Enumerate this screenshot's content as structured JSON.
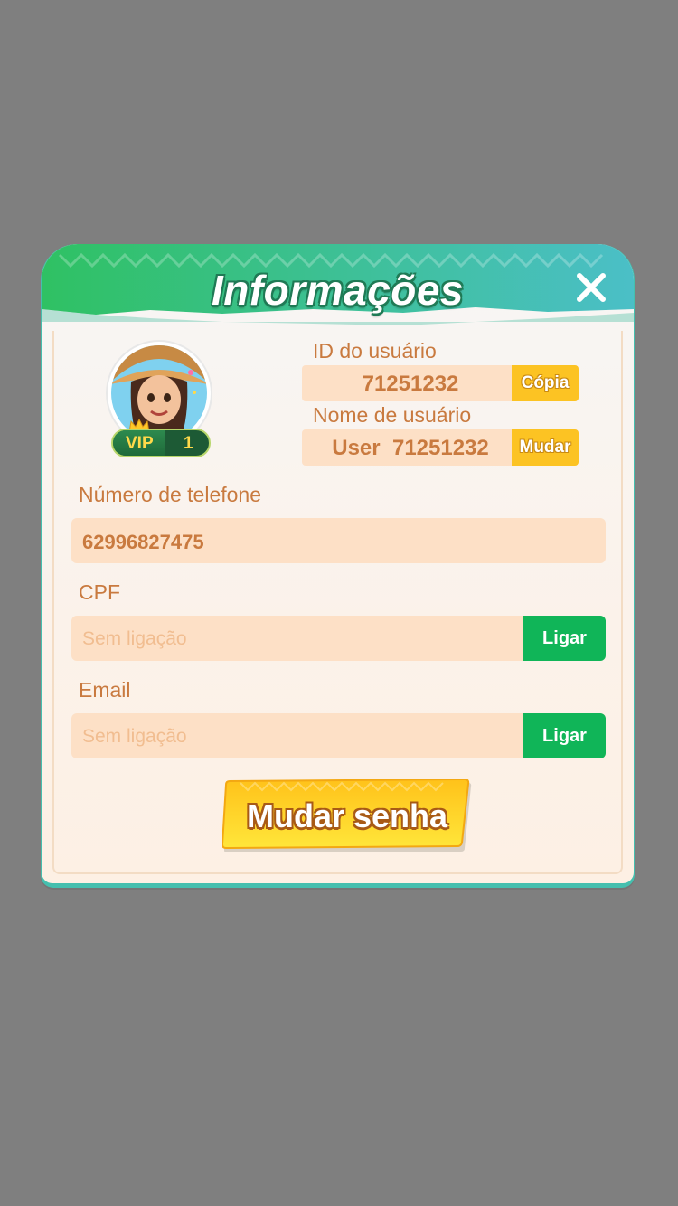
{
  "dialog": {
    "title": "Informações",
    "close_icon": "close-icon"
  },
  "profile": {
    "avatar_icon": "avatar-girl",
    "vip_label": "VIP",
    "vip_level": "1",
    "id_label": "ID do usuário",
    "id_value": "71251232",
    "copy_button": "Cópia",
    "username_label": "Nome de usuário",
    "username_value": "User_71251232",
    "change_button": "Mudar"
  },
  "phone": {
    "label": "Número de telefone",
    "value": "62996827475"
  },
  "cpf": {
    "label": "CPF",
    "placeholder": "Sem ligação",
    "button": "Ligar"
  },
  "email": {
    "label": "Email",
    "placeholder": "Sem ligação",
    "button": "Ligar"
  },
  "change_password_button": "Mudar senha",
  "colors": {
    "header_green": "#2cbf6a",
    "header_teal": "#49bfc3",
    "field_bg": "#fde0c6",
    "text_orange": "#c97a3f",
    "button_yellow": "#fcc323",
    "button_green": "#10b558"
  }
}
